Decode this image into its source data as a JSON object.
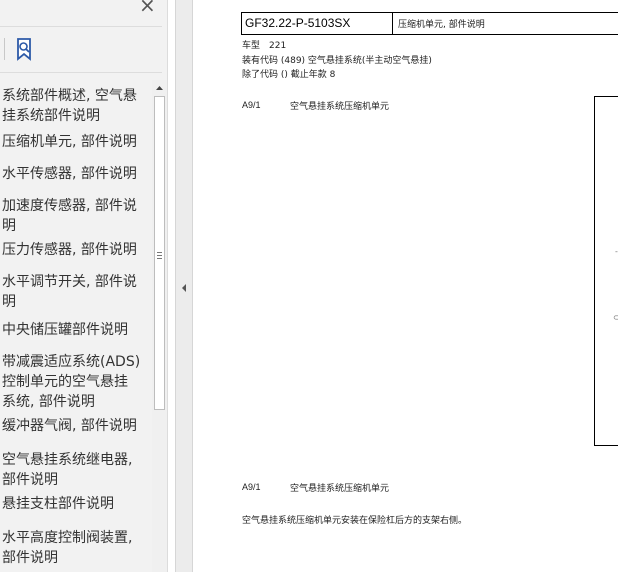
{
  "sidebar": {
    "close_symbol": "×",
    "bookmark_icon": "bookmark-search-icon",
    "toc_items": [
      "系统部件概述, 空气悬\n挂系统部件说明",
      "压缩机单元, 部件说明",
      "水平传感器, 部件说明",
      "加速度传感器, 部件说\n明",
      "压力传感器, 部件说明",
      "水平调节开关, 部件说\n明",
      "中央储压罐部件说明",
      "带减震适应系统(ADS)\n控制单元的空气悬挂\n系统, 部件说明",
      "缓冲器气阀, 部件说明",
      "空气悬挂系统继电器,\n部件说明",
      "悬挂支柱部件说明",
      "水平高度控制阀装置,\n部件说明"
    ]
  },
  "document": {
    "doc_id": "GF32.22-P-5103SX",
    "doc_title": "压缩机单元, 部件说明",
    "model_line": "车型　221",
    "code_line": "装有代码 (489) 空气悬挂系统(半主动空气悬挂)",
    "except_line": "除了代码 () 截止年款 8",
    "label1_code": "A9/1",
    "label1_text": "空气悬挂系统压缩机单元",
    "figure_mark1": "-",
    "figure_mark2": "⊂",
    "label2_code": "A9/1",
    "label2_text": "空气悬挂系统压缩机单元",
    "description": "空气悬挂系统压缩机单元安装在保险杠后方的支架右侧。"
  }
}
